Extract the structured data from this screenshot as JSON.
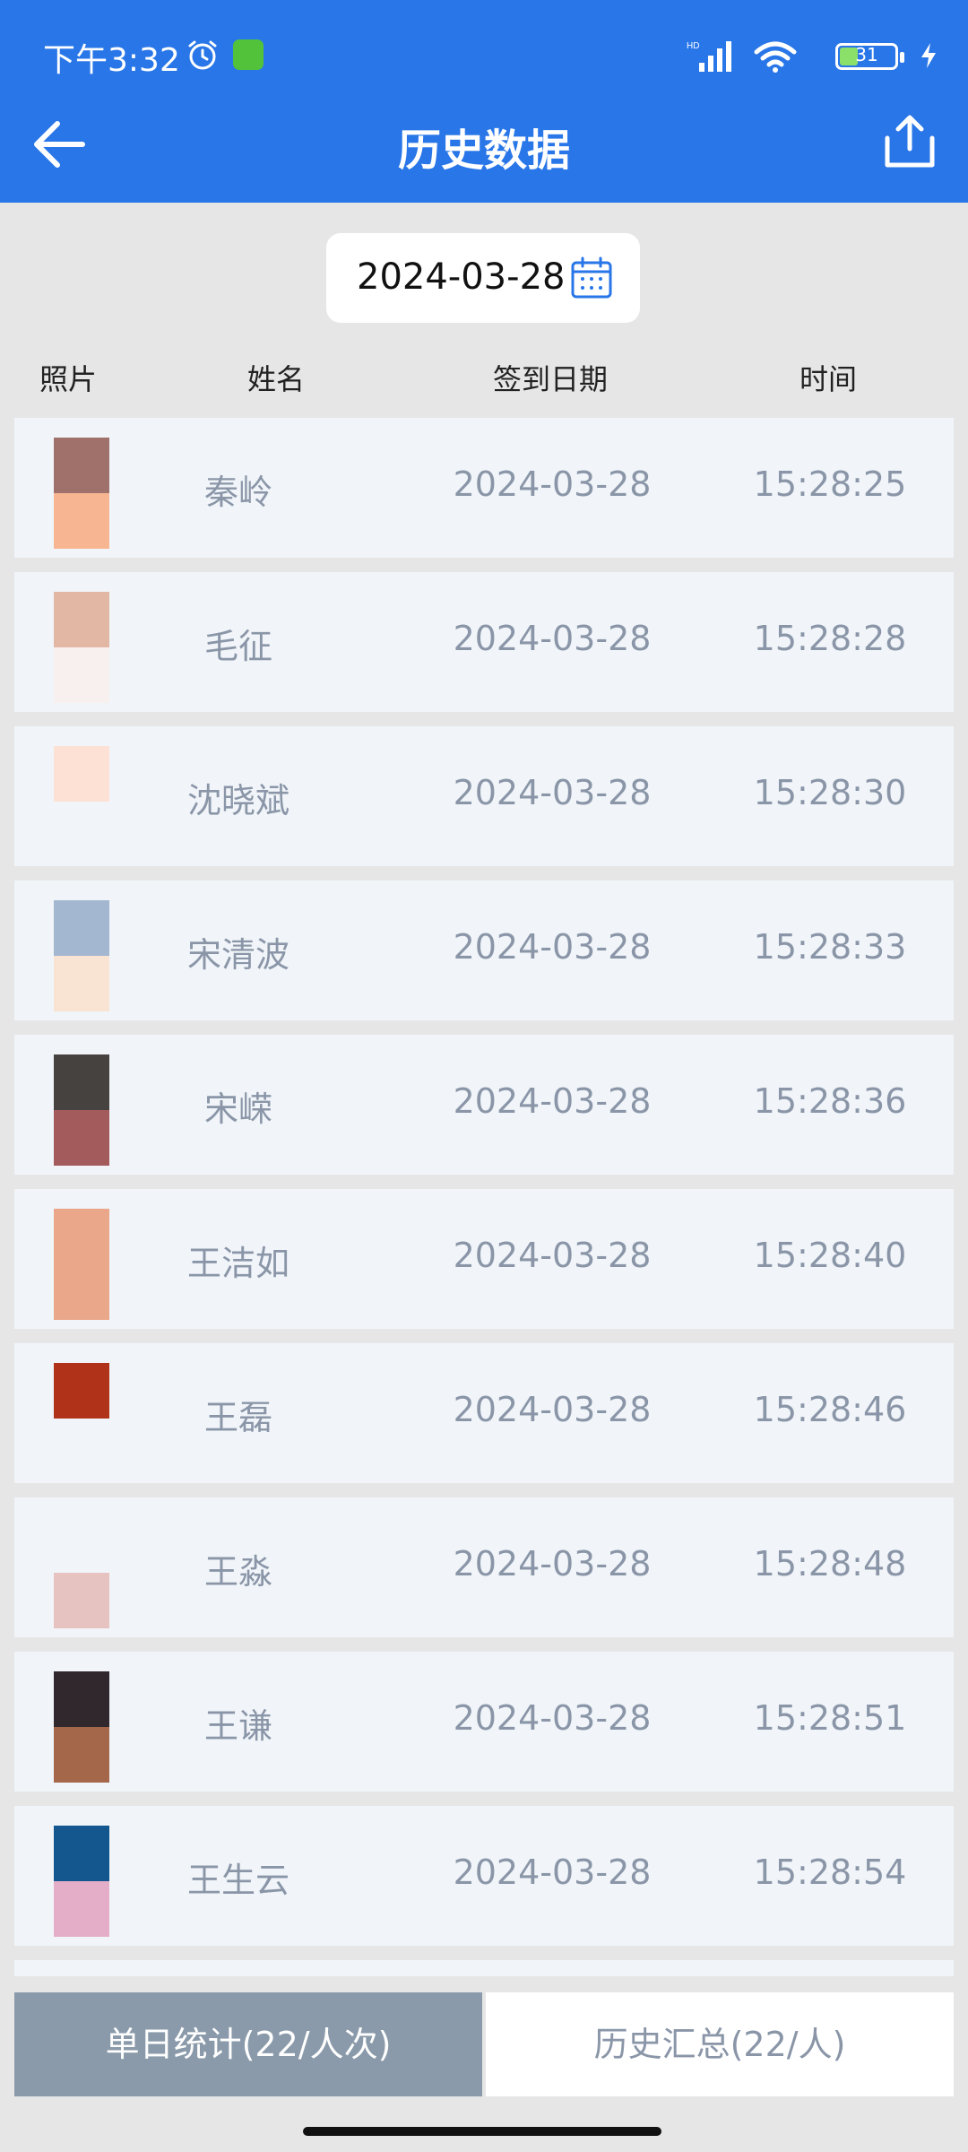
{
  "status_bar": {
    "time": "下午3:32",
    "battery": "31"
  },
  "nav": {
    "title": "历史数据"
  },
  "date_picker": {
    "value": "2024-03-28"
  },
  "columns": {
    "photo": "照片",
    "name": "姓名",
    "date": "签到日期",
    "time": "时间"
  },
  "rows": [
    {
      "name": "秦岭",
      "date": "2024-03-28",
      "time": "15:28:25",
      "photo_colors": [
        "#a0716b",
        "#f7b592"
      ]
    },
    {
      "name": "毛征",
      "date": "2024-03-28",
      "time": "15:28:28",
      "photo_colors": [
        "#e2b7a3",
        "#f8f0ef"
      ]
    },
    {
      "name": "沈晓斌",
      "date": "2024-03-28",
      "time": "15:28:30",
      "photo_colors": [
        "#fde1d5",
        "#f1f5f9"
      ]
    },
    {
      "name": "宋清波",
      "date": "2024-03-28",
      "time": "15:28:33",
      "photo_colors": [
        "#a3b7d1",
        "#f9e4d4"
      ]
    },
    {
      "name": "宋嵘",
      "date": "2024-03-28",
      "time": "15:28:36",
      "photo_colors": [
        "#464240",
        "#a45b5b"
      ]
    },
    {
      "name": "王洁如",
      "date": "2024-03-28",
      "time": "15:28:40",
      "photo_colors": [
        "#eba78a",
        "#eba78a"
      ]
    },
    {
      "name": "王磊",
      "date": "2024-03-28",
      "time": "15:28:46",
      "photo_colors": [
        "#b03218",
        "#f1f5f9"
      ]
    },
    {
      "name": "王淼",
      "date": "2024-03-28",
      "time": "15:28:48",
      "photo_colors": [
        "#f1f5f9",
        "#e6c3c1"
      ]
    },
    {
      "name": "王谦",
      "date": "2024-03-28",
      "time": "15:28:51",
      "photo_colors": [
        "#31282d",
        "#a4674a"
      ]
    },
    {
      "name": "王生云",
      "date": "2024-03-28",
      "time": "15:28:54",
      "photo_colors": [
        "#14568e",
        "#e5aec8"
      ]
    }
  ],
  "tabs": {
    "daily": "单日统计(22/人次)",
    "history": "历史汇总(22/人)"
  },
  "colors": {
    "header": "#2876e8",
    "row_bg": "#f1f5f9",
    "active_tab": "#8a9aaa",
    "muted_text": "#8a96a8"
  },
  "icons": [
    "alarm-icon",
    "app-notification-icon",
    "signal-icon",
    "wifi-icon",
    "battery-icon",
    "charging-icon",
    "back-arrow-icon",
    "share-icon",
    "calendar-icon"
  ]
}
